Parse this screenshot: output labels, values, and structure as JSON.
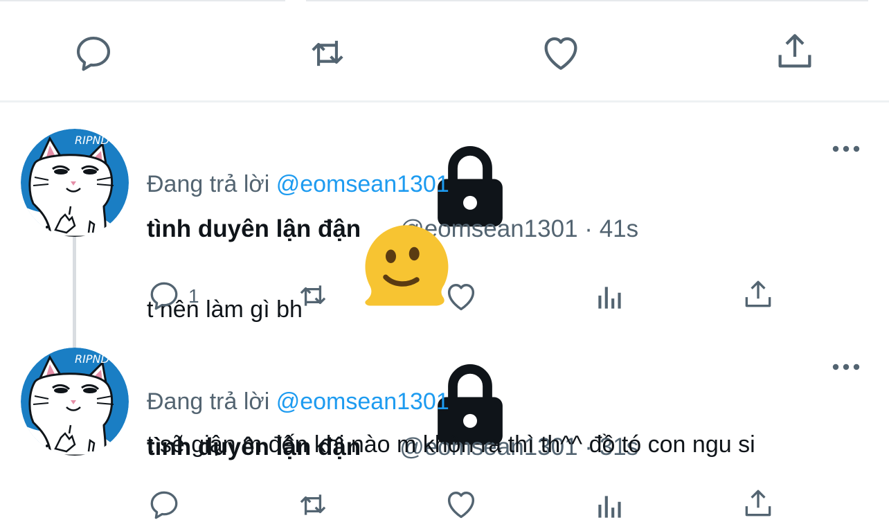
{
  "tweets": [
    {
      "display_name": "tình duyên lận đận",
      "handle": "@eomsean1301",
      "separator": "·",
      "time": "41s",
      "replying_prefix": "Đang trả lời",
      "replying_to": "@eomsean1301",
      "text": "t nên làm gì bh",
      "reply_count": "1",
      "avatar_text": "RIPND"
    },
    {
      "display_name": "tình duyên lận đận",
      "handle": "@eomsean1301",
      "separator": "·",
      "time": "31s",
      "replying_prefix": "Đang trả lời",
      "replying_to": "@eomsean1301",
      "text": "t sẽ giận m đến khi nào m khôn ra thì th^^ đồ tó con ngu si",
      "reply_count": "",
      "avatar_text": "RIPND"
    }
  ],
  "icons": {
    "reply": "reply-icon",
    "retweet": "retweet-icon",
    "like": "like-icon",
    "views": "views-icon",
    "share": "share-icon",
    "more": "more-icon",
    "lock": "lock-icon",
    "emoji": "melting-face-emoji"
  },
  "colors": {
    "icon_gray": "#536471",
    "link_blue": "#1d9bf0",
    "avatar_blue": "#1a7ec4",
    "text": "#0f1419"
  }
}
